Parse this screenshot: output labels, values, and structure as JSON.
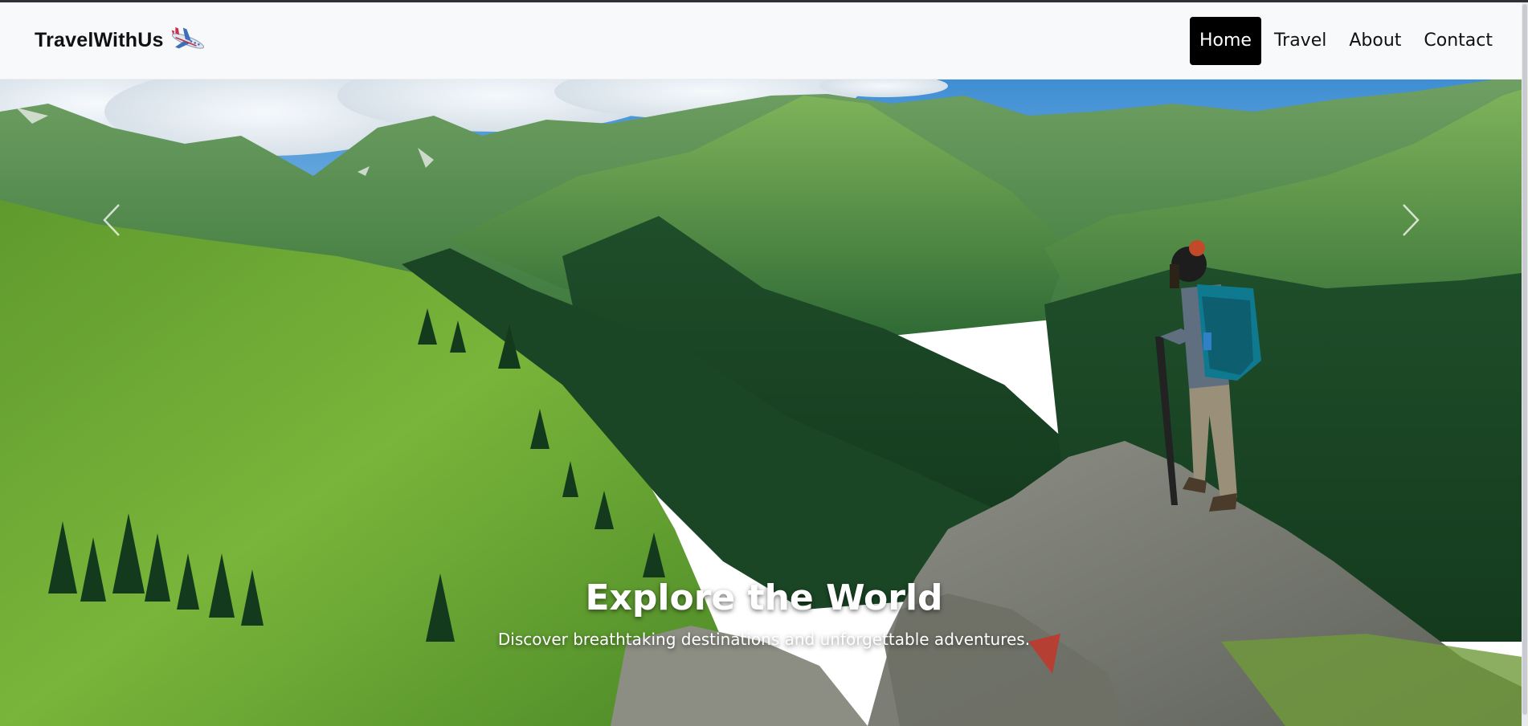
{
  "brand": {
    "name": "TravelWithUs",
    "icon": "airplane-icon"
  },
  "nav": {
    "items": [
      {
        "label": "Home",
        "active": true
      },
      {
        "label": "Travel",
        "active": false
      },
      {
        "label": "About",
        "active": false
      },
      {
        "label": "Contact",
        "active": false
      }
    ]
  },
  "hero": {
    "title": "Explore the World",
    "subtitle": "Discover breathtaking destinations and unforgettable adventures.",
    "prev_icon": "chevron-left-icon",
    "next_icon": "chevron-right-icon"
  },
  "colors": {
    "active_bg": "#000000",
    "navbar_bg": "#f8f9fb",
    "sky": "#5ea3d8"
  }
}
